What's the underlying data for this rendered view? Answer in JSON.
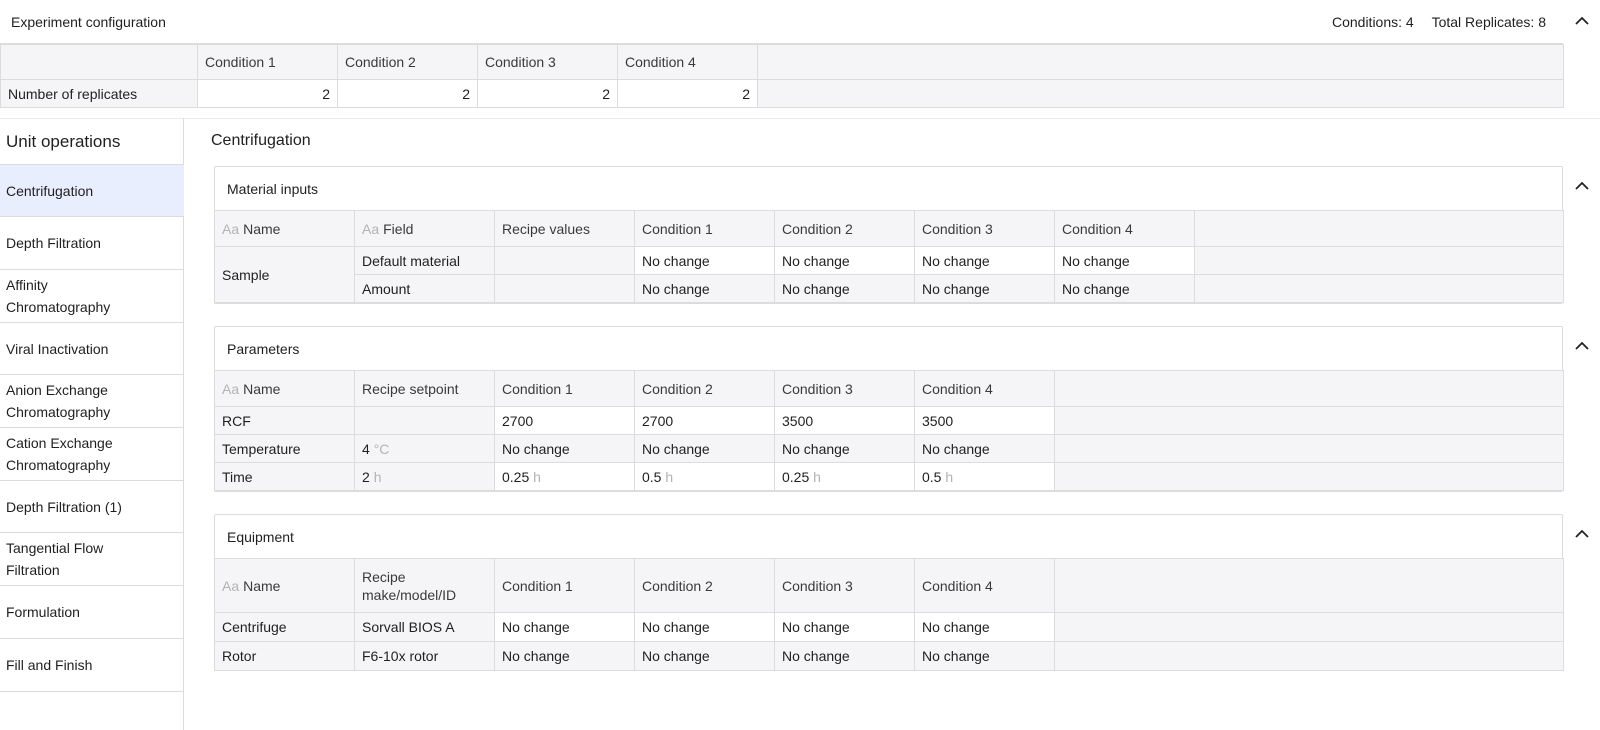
{
  "experiment": {
    "title": "Experiment configuration",
    "conditions_label": "Conditions:",
    "conditions_value": "4",
    "replicates_label": "Total Replicates:",
    "replicates_value": "8",
    "columns": [
      "Condition 1",
      "Condition 2",
      "Condition 3",
      "Condition 4"
    ],
    "row_label": "Number of replicates",
    "replicates": [
      "2",
      "2",
      "2",
      "2"
    ]
  },
  "sidebar": {
    "title": "Unit operations",
    "items": [
      {
        "label": "Centrifugation",
        "active": true
      },
      {
        "label": "Depth Filtration"
      },
      {
        "label": "Affinity Chromatography"
      },
      {
        "label": "Viral Inactivation"
      },
      {
        "label": "Anion Exchange Chromatography"
      },
      {
        "label": "Cation Exchange Chromatography"
      },
      {
        "label": "Depth Filtration (1)"
      },
      {
        "label": "Tangential Flow Filtration"
      },
      {
        "label": "Formulation"
      },
      {
        "label": "Fill and Finish"
      }
    ]
  },
  "main": {
    "title": "Centrifugation",
    "material_inputs": {
      "title": "Material inputs",
      "headers": {
        "aa": "Aa",
        "name": "Name",
        "field": "Field",
        "recipe": "Recipe values",
        "c1": "Condition 1",
        "c2": "Condition 2",
        "c3": "Condition 3",
        "c4": "Condition 4"
      },
      "group_name": "Sample",
      "rows": [
        {
          "field": "Default material",
          "recipe": "",
          "c1": "No change",
          "c2": "No change",
          "c3": "No change",
          "c4": "No change"
        },
        {
          "field": "Amount",
          "recipe": "",
          "c1": "No change",
          "c2": "No change",
          "c3": "No change",
          "c4": "No change"
        }
      ]
    },
    "parameters": {
      "title": "Parameters",
      "headers": {
        "aa": "Aa",
        "name": "Name",
        "setpoint": "Recipe setpoint",
        "c1": "Condition 1",
        "c2": "Condition 2",
        "c3": "Condition 3",
        "c4": "Condition 4"
      },
      "rows": [
        {
          "name": "RCF",
          "setpoint": "",
          "setpoint_unit": "",
          "c1": "2700",
          "c1_unit": "",
          "c2": "2700",
          "c2_unit": "",
          "c3": "3500",
          "c3_unit": "",
          "c4": "3500",
          "c4_unit": ""
        },
        {
          "name": "Temperature",
          "setpoint": "4",
          "setpoint_unit": "°C",
          "c1": "No change",
          "c1_unit": "",
          "c2": "No change",
          "c2_unit": "",
          "c3": "No change",
          "c3_unit": "",
          "c4": "No change",
          "c4_unit": ""
        },
        {
          "name": "Time",
          "setpoint": "2",
          "setpoint_unit": "h",
          "c1": "0.25",
          "c1_unit": "h",
          "c2": "0.5",
          "c2_unit": "h",
          "c3": "0.25",
          "c3_unit": "h",
          "c4": "0.5",
          "c4_unit": "h"
        }
      ]
    },
    "equipment": {
      "title": "Equipment",
      "headers": {
        "aa": "Aa",
        "name": "Name",
        "recipe_line1": "Recipe",
        "recipe_line2": "make/model/ID",
        "c1": "Condition 1",
        "c2": "Condition 2",
        "c3": "Condition 3",
        "c4": "Condition 4"
      },
      "rows": [
        {
          "name": "Centrifuge",
          "recipe": "Sorvall BIOS A",
          "c1": "No change",
          "c2": "No change",
          "c3": "No change",
          "c4": "No change"
        },
        {
          "name": "Rotor",
          "recipe": "F6-10x rotor",
          "c1": "No change",
          "c2": "No change",
          "c3": "No change",
          "c4": "No change"
        }
      ]
    }
  }
}
